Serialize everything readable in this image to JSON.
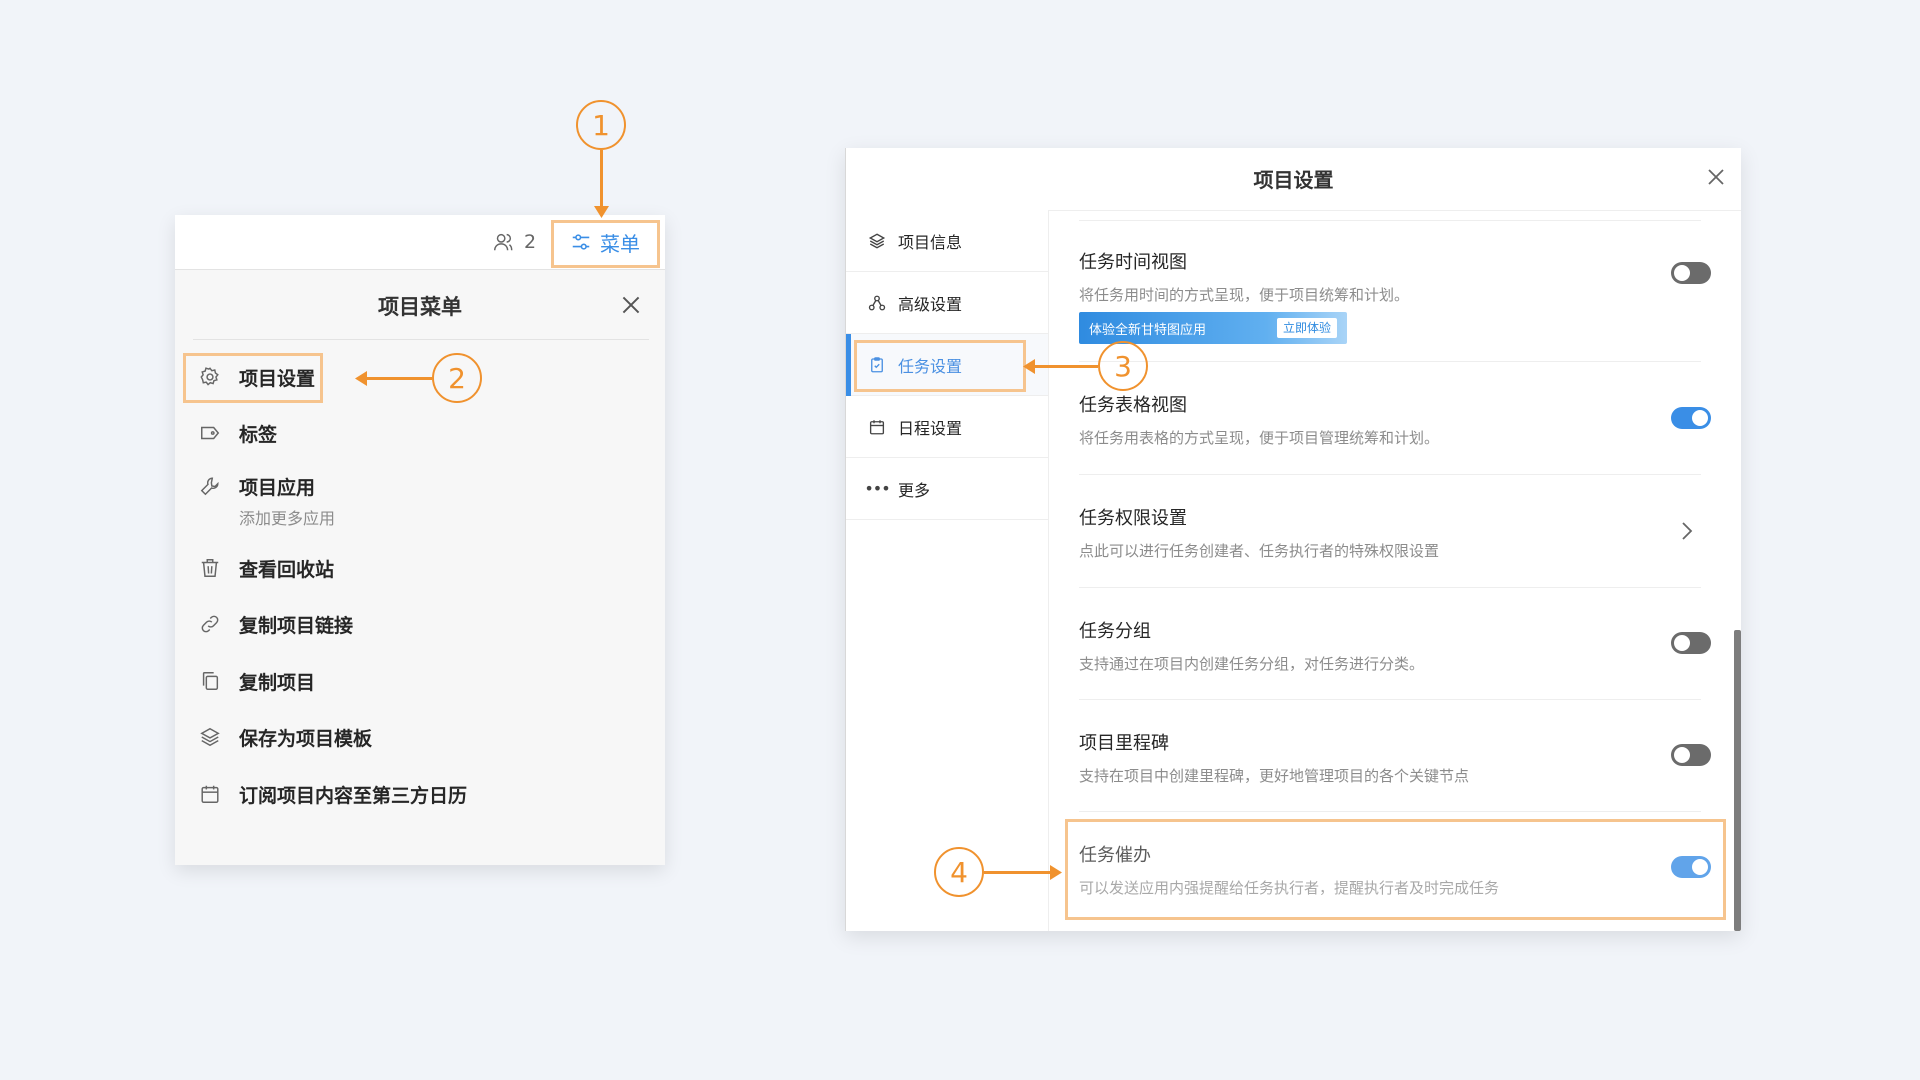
{
  "left_panel": {
    "member_count": "2",
    "menu_button_label": "菜单",
    "title": "项目菜单",
    "items": [
      {
        "label": "项目设置",
        "icon": "gear-icon"
      },
      {
        "label": "标签",
        "icon": "tag-icon"
      },
      {
        "label": "项目应用",
        "sub": "添加更多应用",
        "icon": "wrench-icon"
      },
      {
        "label": "查看回收站",
        "icon": "trash-icon"
      },
      {
        "label": "复制项目链接",
        "icon": "link-icon"
      },
      {
        "label": "复制项目",
        "icon": "copy-icon"
      },
      {
        "label": "保存为项目模板",
        "icon": "layers-icon"
      },
      {
        "label": "订阅项目内容至第三方日历",
        "icon": "calendar-icon"
      }
    ]
  },
  "right_panel": {
    "title": "项目设置",
    "sidebar": [
      {
        "label": "项目信息",
        "icon": "layers-icon"
      },
      {
        "label": "高级设置",
        "icon": "nodes-icon"
      },
      {
        "label": "任务设置",
        "icon": "clipboard-icon",
        "active": true
      },
      {
        "label": "日程设置",
        "icon": "calendar-icon"
      },
      {
        "label": "更多",
        "icon": "more-icon"
      }
    ],
    "settings": [
      {
        "title": "任务时间视图",
        "desc": "将任务用时间的方式呈现，便于项目统筹和计划。",
        "control": "toggle",
        "on": false
      },
      {
        "title": "任务表格视图",
        "desc": "将任务用表格的方式呈现，便于项目管理统筹和计划。",
        "control": "toggle",
        "on": true
      },
      {
        "title": "任务权限设置",
        "desc": "点此可以进行任务创建者、任务执行者的特殊权限设置",
        "control": "chevron"
      },
      {
        "title": "任务分组",
        "desc": "支持通过在项目内创建任务分组，对任务进行分类。",
        "control": "toggle",
        "on": false
      },
      {
        "title": "项目里程碑",
        "desc": "支持在项目中创建里程碑，更好地管理项目的各个关键节点",
        "control": "toggle",
        "on": false
      },
      {
        "title": "任务催办",
        "desc": "可以发送应用内强提醒给任务执行者，提醒执行者及时完成任务",
        "control": "toggle",
        "on": true
      }
    ],
    "promo": {
      "text": "体验全新甘特图应用",
      "button": "立即体验"
    }
  },
  "callouts": [
    "1",
    "2",
    "3",
    "4"
  ],
  "colors": {
    "accent": "#3a8ee6",
    "callout": "#f0922e",
    "highlight": "#f6c48e"
  }
}
